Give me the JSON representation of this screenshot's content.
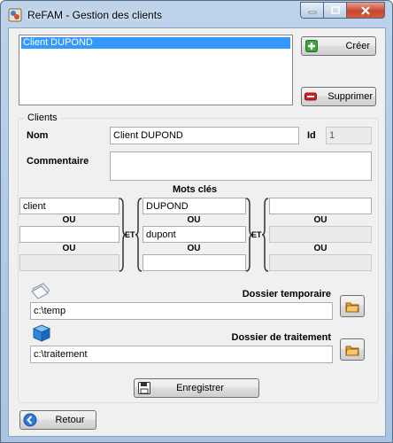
{
  "window": {
    "title": "ReFAM - Gestion des clients"
  },
  "client_list": {
    "items": [
      "Client DUPOND"
    ]
  },
  "buttons": {
    "create": "Créer",
    "delete": "Supprimer",
    "save": "Enregistrer",
    "back": "Retour"
  },
  "clients_group": {
    "legend": "Clients",
    "nom_label": "Nom",
    "nom_value": "Client DUPOND",
    "id_label": "Id",
    "id_value": "1",
    "commentaire_label": "Commentaire",
    "commentaire_value": ""
  },
  "keywords": {
    "title": "Mots clés",
    "or_label": "OU",
    "and_label": "ET",
    "col1": [
      "client",
      "",
      ""
    ],
    "col2": [
      "DUPOND",
      "dupont",
      ""
    ],
    "col3": [
      "",
      "",
      ""
    ]
  },
  "folders": {
    "temp_label": "Dossier temporaire",
    "temp_value": "c:\\temp",
    "processing_label": "Dossier de traitement",
    "processing_value": "c:\\traitement"
  },
  "icons": {
    "app": "refam-app-icon",
    "create": "plus-icon",
    "delete": "minus-icon",
    "save": "floppy-disk-icon",
    "back": "back-arrow-icon",
    "folder_browse": "folder-icon",
    "temp": "papers-icon",
    "processing": "blue-cube-icon"
  },
  "colors": {
    "selection": "#3399ff",
    "create_green": "#3aa83a",
    "delete_red": "#d42020"
  }
}
